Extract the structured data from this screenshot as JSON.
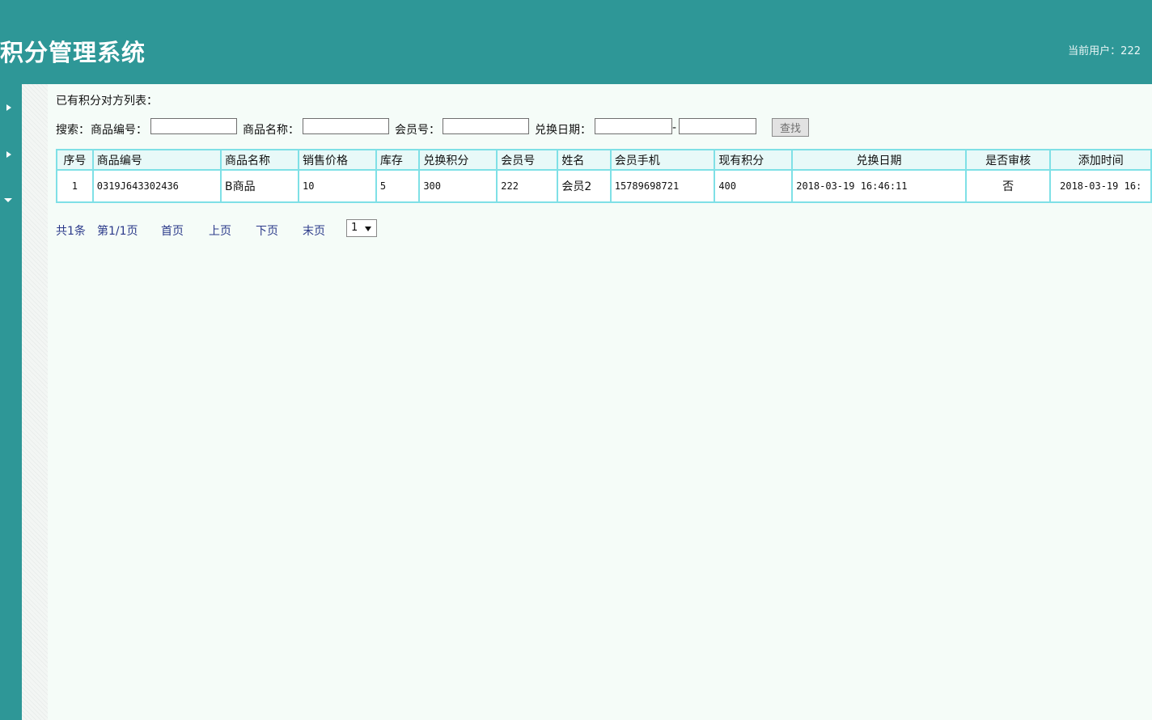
{
  "header": {
    "title": "积分管理系统",
    "current_user_label": "当前用户：222"
  },
  "main": {
    "list_heading": "已有积分对方列表：",
    "search": {
      "label": "搜索：",
      "product_code_label": "商品编号：",
      "product_name_label": "商品名称：",
      "member_no_label": "会员号：",
      "date_label": "兑换日期：",
      "date_separator": "-",
      "button_label": "查找"
    },
    "table": {
      "columns": [
        "序号",
        "商品编号",
        "商品名称",
        "销售价格",
        "库存",
        "兑换积分",
        "会员号",
        "姓名",
        "会员手机",
        "现有积分",
        "兑换日期",
        "是否审核",
        "添加时间"
      ],
      "rows": [
        [
          "1",
          "0319J643302436",
          "B商品",
          "10",
          "5",
          "300",
          "222",
          "会员2",
          "15789698721",
          "400",
          "2018-03-19 16:46:11",
          "否",
          "2018-03-19 16:"
        ]
      ]
    },
    "pager": {
      "total": "共1条",
      "page_info": "第1/1页",
      "first": "首页",
      "prev": "上页",
      "next": "下页",
      "last": "末页",
      "page_select_value": "1"
    }
  },
  "colors": {
    "header_bg": "#2e9797",
    "content_bg": "#f5fcf8",
    "table_border": "#7fe0e6",
    "link": "#2b3a8a"
  },
  "icons": [
    "caret-right-icon",
    "caret-right-icon",
    "caret-down-icon"
  ]
}
